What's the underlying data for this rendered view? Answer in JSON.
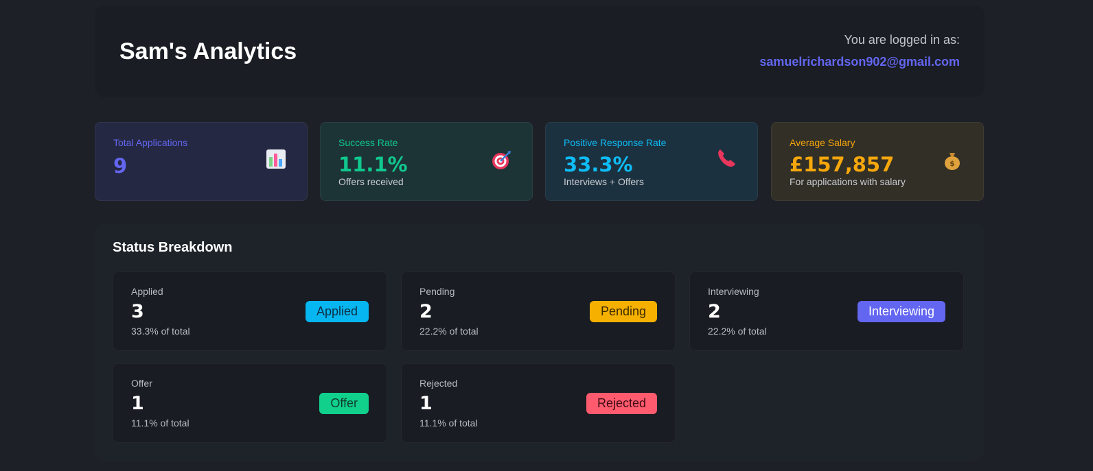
{
  "header": {
    "title": "Sam's Analytics",
    "login_label": "You are logged in as:",
    "email": "samuelrichardson902@gmail.com"
  },
  "stats": [
    {
      "label": "Total Applications",
      "value": "9",
      "sub": "",
      "icon": "bar-chart-icon",
      "color": "#6366f1"
    },
    {
      "label": "Success Rate",
      "value": "11.1%",
      "sub": "Offers received",
      "icon": "target-icon",
      "color": "#10c98f"
    },
    {
      "label": "Positive Response Rate",
      "value": "33.3%",
      "sub": "Interviews + Offers",
      "icon": "phone-icon",
      "color": "#0ebcf5"
    },
    {
      "label": "Average Salary",
      "value": "£157,857",
      "sub": "For applications with salary",
      "icon": "money-bag-icon",
      "color": "#f5a70b"
    }
  ],
  "status_breakdown": {
    "title": "Status Breakdown",
    "items": [
      {
        "name": "Applied",
        "count": "3",
        "pct": "33.3% of total",
        "badge": "Applied",
        "badge_color": "#06b6f0"
      },
      {
        "name": "Pending",
        "count": "2",
        "pct": "22.2% of total",
        "badge": "Pending",
        "badge_color": "#f5b000"
      },
      {
        "name": "Interviewing",
        "count": "2",
        "pct": "22.2% of total",
        "badge": "Interviewing",
        "badge_color": "#6366f1"
      },
      {
        "name": "Offer",
        "count": "1",
        "pct": "11.1% of total",
        "badge": "Offer",
        "badge_color": "#10d08c"
      },
      {
        "name": "Rejected",
        "count": "1",
        "pct": "11.1% of total",
        "badge": "Rejected",
        "badge_color": "#ff5a6e"
      }
    ]
  }
}
